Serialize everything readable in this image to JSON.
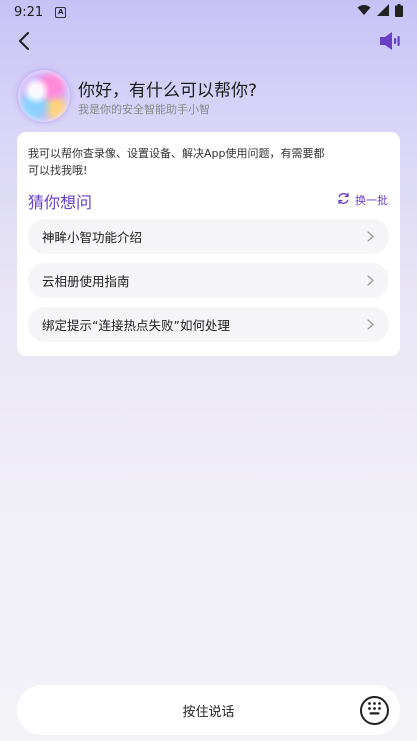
{
  "status_bar": {
    "time": "9:21",
    "icons": [
      "a-notification-icon",
      "wifi-icon",
      "cellular-signal-icon",
      "battery-icon"
    ]
  },
  "nav": {
    "back_icon": "chevron-left-icon",
    "speaker_icon": "speaker-icon",
    "accent_color": "#6a3fc8"
  },
  "hero": {
    "title": "你好，有什么可以帮你?",
    "subtitle": "我是你的安全智能助手小智"
  },
  "card": {
    "intro": "我可以帮你查录像、设置设备、解决App使用问题，有需要都可以找我哦!",
    "guess_title": "猜你想问",
    "refresh_label": "换一批",
    "questions": [
      {
        "label": "神眸小智功能介绍"
      },
      {
        "label": "云相册使用指南"
      },
      {
        "label": "绑定提示“连接热点失败”如何处理"
      }
    ]
  },
  "bottom": {
    "hold_to_talk_label": "按住说话",
    "keyboard_icon": "keyboard-icon"
  }
}
